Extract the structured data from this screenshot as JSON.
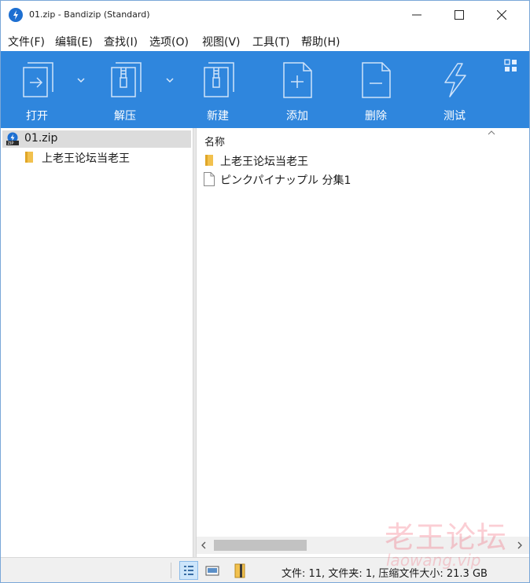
{
  "window": {
    "title": "01.zip - Bandizip (Standard)",
    "accent_color": "#2f86dd"
  },
  "window_controls": {
    "minimize_icon": "minimize-icon",
    "maximize_icon": "maximize-icon",
    "close_icon": "close-icon"
  },
  "menu": {
    "items": [
      "文件(F)",
      "编辑(E)",
      "查找(I)",
      "选项(O)",
      "视图(V)",
      "工具(T)",
      "帮助(H)"
    ]
  },
  "toolbar": {
    "buttons": [
      {
        "label": "打开",
        "icon": "open-archive-icon"
      },
      {
        "label": "解压",
        "icon": "extract-icon"
      },
      {
        "label": "新建",
        "icon": "new-archive-icon"
      },
      {
        "label": "添加",
        "icon": "add-file-icon"
      },
      {
        "label": "删除",
        "icon": "delete-file-icon"
      },
      {
        "label": "测试",
        "icon": "test-icon"
      }
    ]
  },
  "tree": {
    "root": "01.zip",
    "children": [
      "上老王论坛当老王"
    ]
  },
  "file_list": {
    "column_name": "名称",
    "rows": [
      {
        "name": "上老王论坛当老王",
        "type": "folder"
      },
      {
        "name": "ピンクパイナップル 分集1",
        "type": "file"
      }
    ]
  },
  "status": {
    "text": "文件: 11, 文件夹: 1, 压缩文件大小: 21.3 GB"
  },
  "watermark": {
    "text": "老王论坛",
    "subtext": "laowang.vip"
  }
}
